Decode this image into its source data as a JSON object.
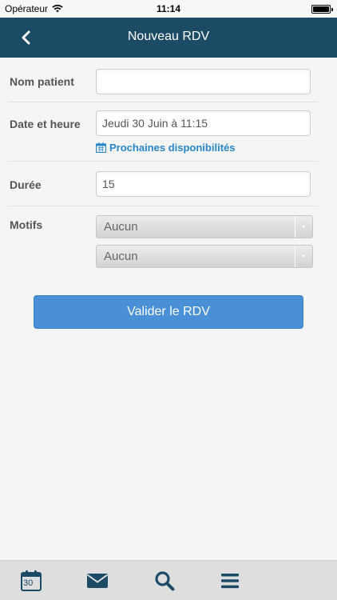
{
  "status_bar": {
    "carrier": "Opérateur",
    "time": "11:14"
  },
  "navbar": {
    "title": "Nouveau RDV",
    "back_icon": "chevron-left-icon"
  },
  "form": {
    "patient": {
      "label": "Nom patient",
      "value": ""
    },
    "datetime": {
      "label": "Date et heure",
      "value": "Jeudi 30 Juin à 11:15",
      "link": "Prochaines disponibilités",
      "link_icon": "calendar-icon"
    },
    "duration": {
      "label": "Durée",
      "value": "15"
    },
    "reasons": {
      "label": "Motifs",
      "options": [
        "Aucun",
        "Aucun"
      ]
    }
  },
  "submit_label": "Valider le RDV",
  "tabbar": {
    "items": [
      {
        "icon": "calendar-icon",
        "day": "30"
      },
      {
        "icon": "envelope-icon"
      },
      {
        "icon": "search-icon"
      },
      {
        "icon": "menu-icon"
      }
    ]
  },
  "colors": {
    "navbar": "#1c4b66",
    "accent": "#4a90d6",
    "link": "#2786c8",
    "tab_icon": "#1c4b66"
  }
}
